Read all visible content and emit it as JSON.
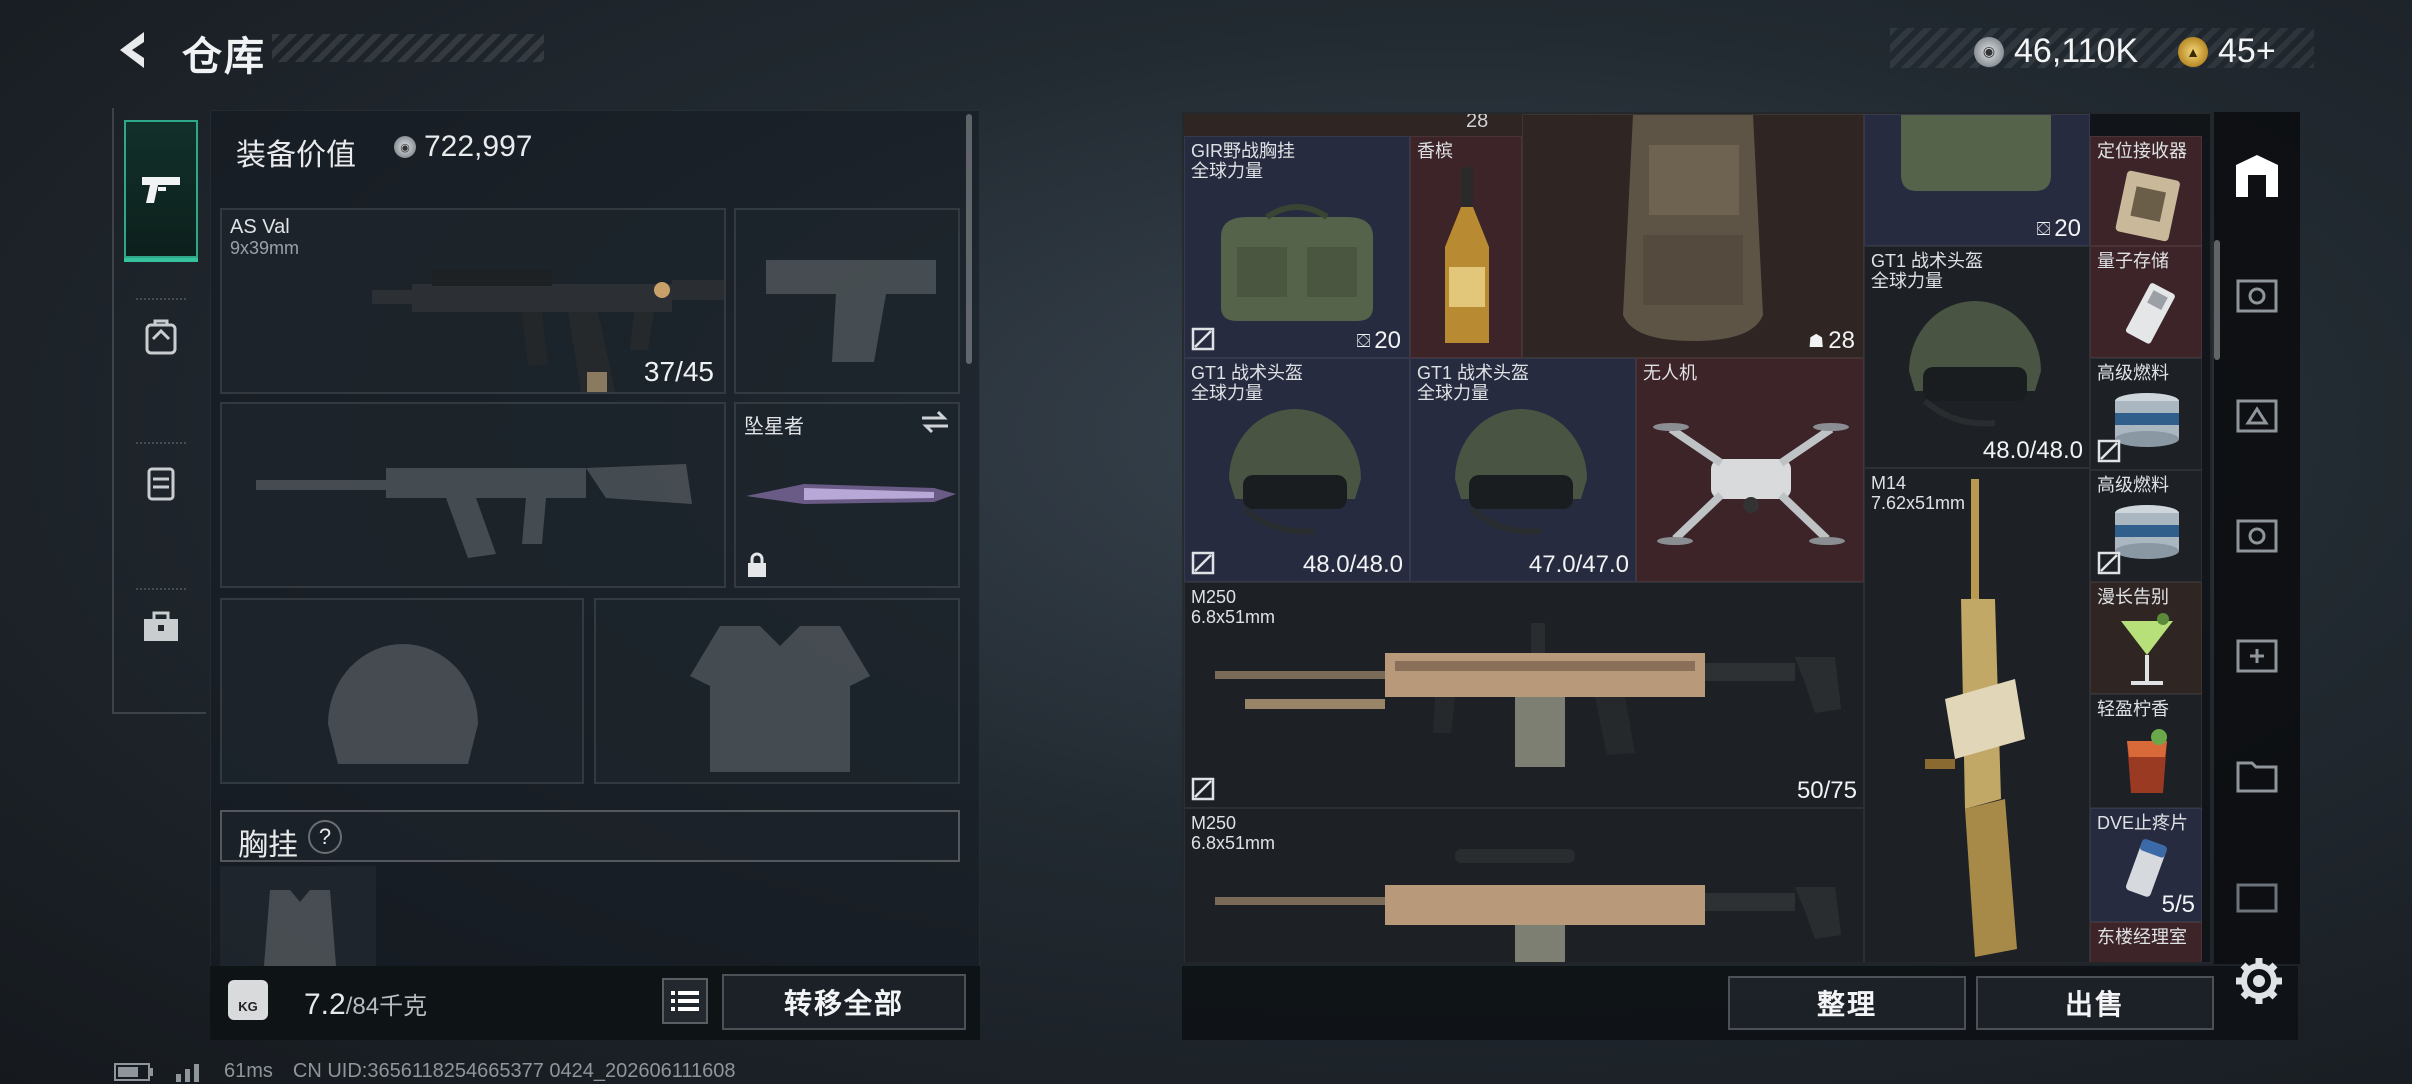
{
  "header": {
    "title": "仓库",
    "silver": "46,110K",
    "gold": "45+"
  },
  "loadout": {
    "value_label": "装备价值",
    "value_amount": "722,997",
    "primary": {
      "name": "AS Val",
      "caliber": "9x39mm",
      "ammo": "37/45"
    },
    "melee": {
      "name": "坠星者"
    },
    "section_chest": "胸挂",
    "weight_value": "7.2",
    "weight_max": "/84千克",
    "weight_icon": "KG",
    "transfer_all": "转移全部"
  },
  "inventory": {
    "top_peek_qty": "28",
    "items": [
      {
        "name": "GIR野战胸挂",
        "sub": "全球力量",
        "qty": "20"
      },
      {
        "name": "香槟"
      },
      {
        "qty": "28"
      },
      {
        "qty": "20"
      },
      {
        "name": "定位接收器"
      },
      {
        "name": "GT1 战术头盔",
        "sub": "全球力量",
        "value": "48.0/48.0"
      },
      {
        "name": "量子存储"
      },
      {
        "name": "GT1 战术头盔",
        "sub": "全球力量",
        "value": "48.0/48.0"
      },
      {
        "name": "GT1 战术头盔",
        "sub": "全球力量",
        "value": "47.0/47.0"
      },
      {
        "name": "无人机"
      },
      {
        "name": "高级燃料"
      },
      {
        "name": "M14",
        "sub": "7.62x51mm"
      },
      {
        "name": "高级燃料"
      },
      {
        "name": "M250",
        "sub": "6.8x51mm",
        "value": "50/75"
      },
      {
        "name": "漫长告别"
      },
      {
        "name": "轻盈柠香"
      },
      {
        "name": "M250",
        "sub": "6.8x51mm"
      },
      {
        "name": "DVE止疼片",
        "value": "5/5"
      },
      {
        "name": "东楼经理室"
      }
    ]
  },
  "actions": {
    "sort": "整理",
    "sell": "出售"
  },
  "status": {
    "ping": "61ms",
    "uid": "CN UID:3656118254665377 0424_202606111608"
  },
  "colors": {
    "accent": "#35c29c",
    "rare_blue": "#272b3f",
    "rare_red": "#3c2428"
  }
}
